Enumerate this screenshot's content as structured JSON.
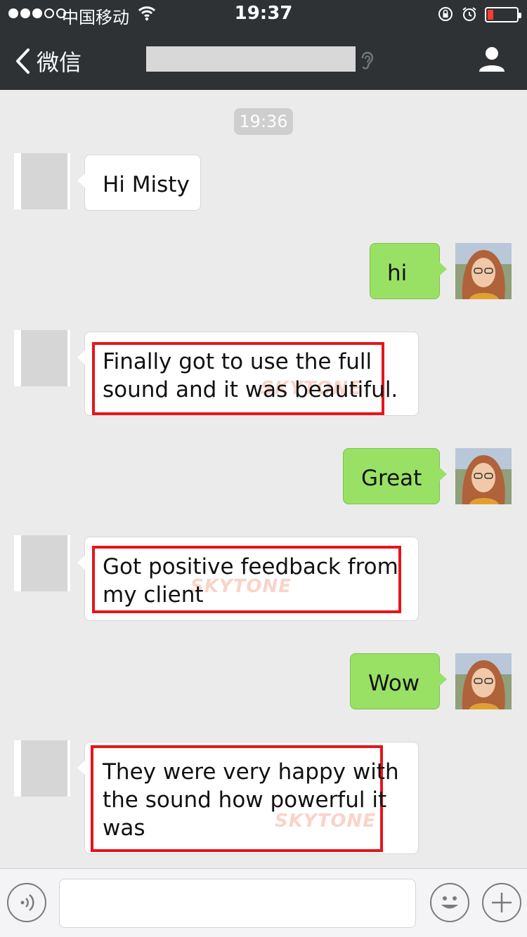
{
  "status_bar": {
    "carrier": "中国移动",
    "time": "19:37"
  },
  "nav": {
    "back_label": "微信"
  },
  "chat": {
    "timestamp": "19:36",
    "messages": [
      {
        "sender": "other",
        "text": "Hi Misty"
      },
      {
        "sender": "me",
        "text": "hi"
      },
      {
        "sender": "other",
        "lines": [
          "Finally got to use the full",
          "sound and it was beautiful."
        ],
        "highlighted": true
      },
      {
        "sender": "me",
        "text": "Great"
      },
      {
        "sender": "other",
        "lines": [
          "Got positive feedback from",
          "my client"
        ],
        "highlighted": true
      },
      {
        "sender": "me",
        "text": "Wow"
      },
      {
        "sender": "other",
        "lines": [
          "They were very happy with",
          "the sound how powerful it",
          "was"
        ],
        "highlighted": true
      }
    ],
    "watermark": "SKYTONE"
  },
  "colors": {
    "nav_bg": "#2e3235",
    "chat_bg": "#ebebeb",
    "my_bubble": "#98e165",
    "highlight_box": "#e8141a"
  },
  "icons": [
    "wifi-icon",
    "rotation-lock-icon",
    "alarm-icon",
    "battery-icon",
    "back-chevron-icon",
    "ear-icon",
    "profile-icon",
    "voice-icon",
    "emoji-icon",
    "plus-icon"
  ]
}
